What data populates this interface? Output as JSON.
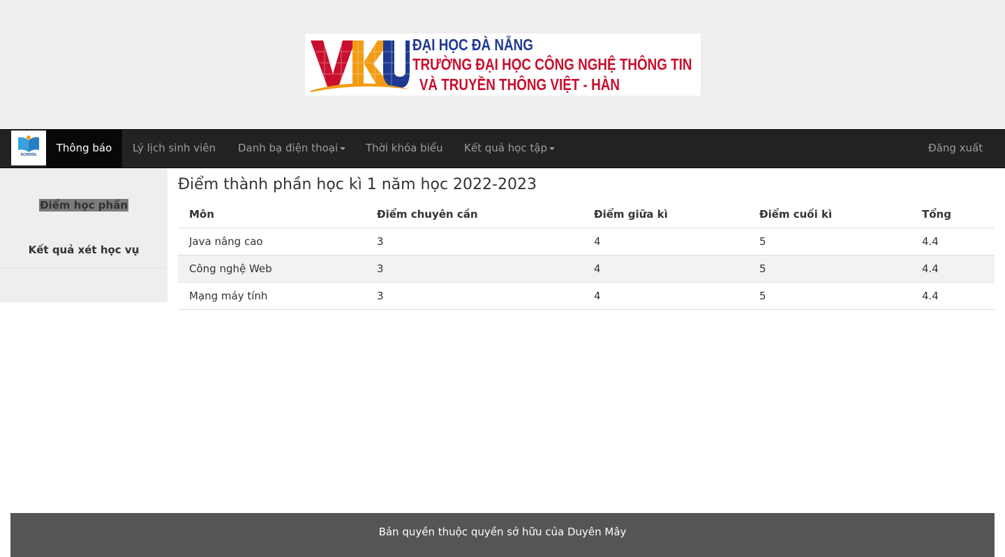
{
  "header": {
    "logo": {
      "mark_letters": "VKU",
      "line1": "ĐẠI HỌC ĐÀ NẴNG",
      "line2": "TRƯỜNG ĐẠI HỌC CÔNG NGHỆ THÔNG TIN",
      "line3": "VÀ TRUYỀN THÔNG VIỆT - HÀN",
      "colors": {
        "red": "#c8102e",
        "blue": "#1f3a93",
        "orange": "#f39c12"
      }
    }
  },
  "navbar": {
    "brand": {
      "icon": "school-book-icon",
      "text": "SCHOOL"
    },
    "items": [
      {
        "label": "Thông báo",
        "active": true
      },
      {
        "label": "Lý lịch sinh viên"
      },
      {
        "label": "Danh bạ điện thoại",
        "dropdown": true
      },
      {
        "label": "Thời khóa biểu"
      },
      {
        "label": "Kết quả học tập",
        "dropdown": true
      }
    ],
    "logout_label": "Đăng xuất",
    "colors": {
      "background": "#222222",
      "active": "#080808",
      "text": "#9d9d9d"
    }
  },
  "sidebar": {
    "items": [
      {
        "label": "Điểm học phần",
        "selected": true
      },
      {
        "label": "Kết quả xét học vụ"
      }
    ]
  },
  "main": {
    "title": "Điểm thành phần học kì 1 năm học 2022-2023",
    "table": {
      "headers": [
        "Môn",
        "Điểm chuyên cần",
        "Điểm giữa kì",
        "Điểm cuối kì",
        "Tổng"
      ],
      "rows": [
        [
          "Java nâng cao",
          "3",
          "4",
          "5",
          "4.4"
        ],
        [
          "Công nghệ Web",
          "3",
          "4",
          "5",
          "4.4"
        ],
        [
          "Mạng máy tính",
          "3",
          "4",
          "5",
          "4.4"
        ]
      ]
    }
  },
  "footer": {
    "text": "Bản quyền thuộc quyền sở hữu của Duyên Mây"
  }
}
